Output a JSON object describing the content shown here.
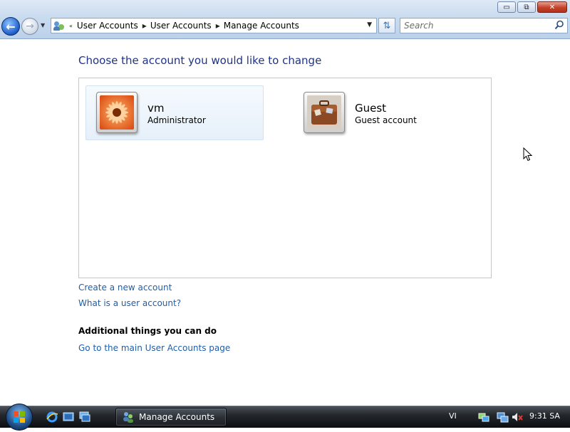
{
  "window": {
    "caption_buttons": {
      "minimize": "▭",
      "maximize": "⧉",
      "close": "✕"
    }
  },
  "navigation": {
    "back_icon": "back-arrow-icon",
    "forward_icon": "forward-arrow-icon",
    "address_separator": "«",
    "breadcrumb": [
      "User Accounts",
      "User Accounts",
      "Manage Accounts"
    ]
  },
  "search": {
    "placeholder": "Search"
  },
  "main": {
    "title": "Choose the account you would like to change",
    "accounts": [
      {
        "name": "vm",
        "type": "Administrator",
        "picture": "flower-picture"
      },
      {
        "name": "Guest",
        "type": "Guest account",
        "picture": "briefcase-picture"
      }
    ],
    "links": {
      "create": "Create a new account",
      "what_is": "What is a user account?"
    },
    "additional": {
      "heading": "Additional things you can do",
      "main_page": "Go to the main User Accounts page"
    }
  },
  "taskbar": {
    "quick_launch": [
      "internet-explorer-icon",
      "show-desktop-icon",
      "switch-windows-icon"
    ],
    "active_window": "Manage Accounts",
    "language": "VI",
    "clock": "9:31 SA"
  },
  "colors": {
    "title_blue": "#1e3287",
    "link_blue": "#1f5ea8",
    "selected_tile": "#e6f0fa"
  }
}
